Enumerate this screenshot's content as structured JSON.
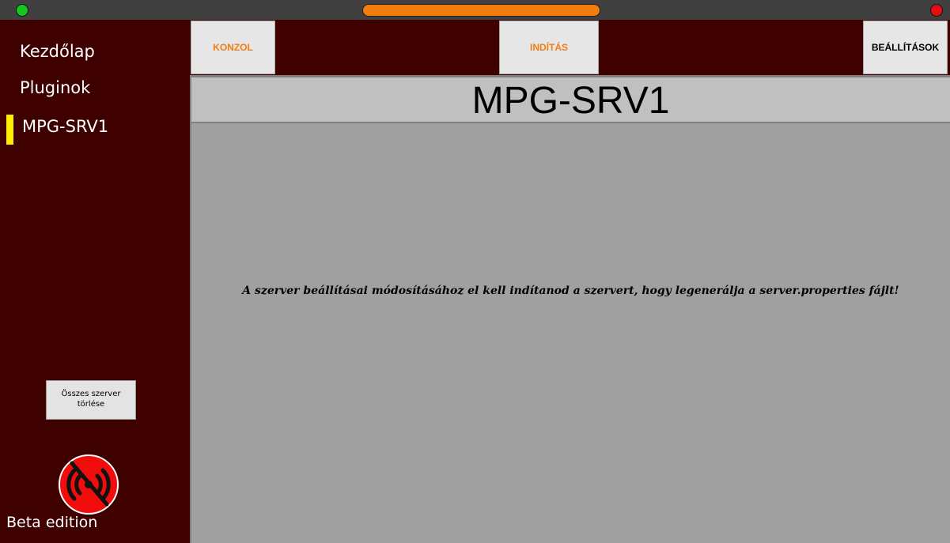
{
  "titlebar": {
    "colors": {
      "close": "#e61010",
      "minimize": "#19c61f",
      "accent": "#f47d10"
    }
  },
  "sidebar": {
    "items": [
      {
        "label": "Kezdőlap",
        "active": false
      },
      {
        "label": "Pluginok",
        "active": false
      },
      {
        "label": "MPG-SRV1",
        "active": true
      }
    ],
    "delete_all_label": "Összes szerver törlése",
    "connection_icon": "no-connection-icon",
    "edition_label": "Beta edition",
    "colors": {
      "background": "#3f0000",
      "active_marker": "#ffee00"
    }
  },
  "toolbar": {
    "konzol_label": "KONZOL",
    "inditas_label": "INDÍTÁS",
    "beallitasok_label": "BEÁLLÍTÁSOK",
    "colors": {
      "accent_text": "#f07d18"
    }
  },
  "main": {
    "server_name": "MPG-SRV1",
    "message": "A szerver beállításai módosításához el kell indítanod a szervert, hogy legenerálja a server.properties fájlt!"
  }
}
